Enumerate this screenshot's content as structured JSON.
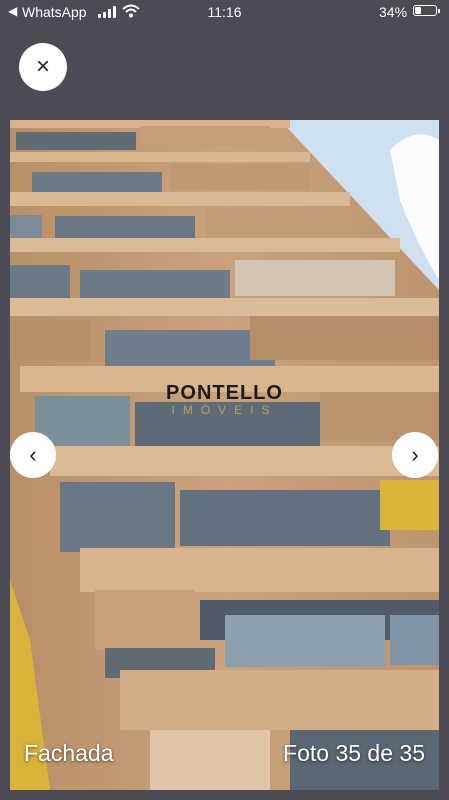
{
  "status_bar": {
    "back_glyph": "◀",
    "app": "WhatsApp",
    "time": "11:16",
    "battery_text": "34%",
    "battery_level": 0.34
  },
  "viewer": {
    "close_icon": "close-icon",
    "close_glyph": "×",
    "prev_glyph": "‹",
    "next_glyph": "›",
    "caption_label": "Fachada",
    "counter": "Foto 35 de 35"
  },
  "watermark": {
    "brand": "PONTELLO",
    "sub": "IMÓVEIS"
  },
  "colors": {
    "background": "#4b4a55",
    "facade": "#c7a07a",
    "sky": "#cfe0f0"
  }
}
